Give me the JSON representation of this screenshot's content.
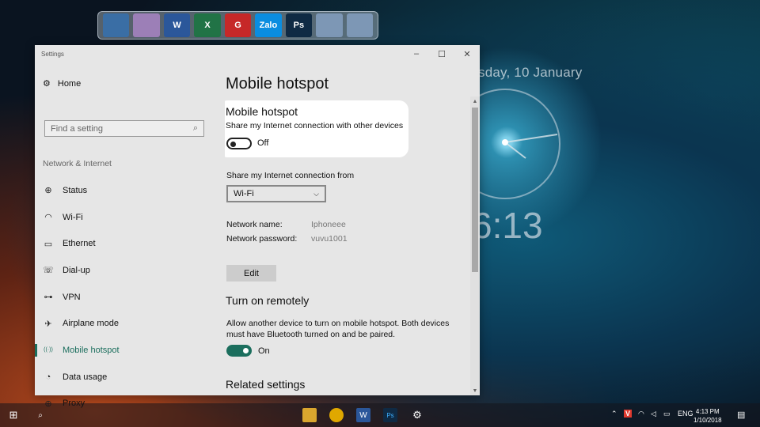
{
  "desktop": {
    "lock_date": "sday, 10 January",
    "lock_time": "6:13"
  },
  "dock": {
    "apps": [
      {
        "name": "this-pc",
        "glyph": "",
        "color": "#3a6ea5"
      },
      {
        "name": "recycle-bin",
        "glyph": "",
        "color": "#9c7fb7"
      },
      {
        "name": "word",
        "glyph": "W",
        "color": "#2b579a"
      },
      {
        "name": "excel",
        "glyph": "X",
        "color": "#217346"
      },
      {
        "name": "garena",
        "glyph": "G",
        "color": "#c62828"
      },
      {
        "name": "zalo",
        "glyph": "Zalo",
        "color": "#0a8de0"
      },
      {
        "name": "photoshop",
        "glyph": "Ps",
        "color": "#0f2a44"
      },
      {
        "name": "folder-1",
        "glyph": "",
        "color": "#7d97b5"
      },
      {
        "name": "folder-2",
        "glyph": "",
        "color": "#7d97b5"
      }
    ]
  },
  "window": {
    "title": "Settings",
    "controls": {
      "minimize": "–",
      "maximize": "☐",
      "close": "✕"
    }
  },
  "nav": {
    "home_label": "Home",
    "search_placeholder": "Find a setting",
    "section": "Network & Internet",
    "items": [
      {
        "label": "Status",
        "icon": "globe-icon",
        "glyph": "⊕"
      },
      {
        "label": "Wi-Fi",
        "icon": "wifi-icon",
        "glyph": "◠"
      },
      {
        "label": "Ethernet",
        "icon": "ethernet-icon",
        "glyph": "▭"
      },
      {
        "label": "Dial-up",
        "icon": "dialup-icon",
        "glyph": "☏"
      },
      {
        "label": "VPN",
        "icon": "vpn-icon",
        "glyph": "⊶"
      },
      {
        "label": "Airplane mode",
        "icon": "airplane-icon",
        "glyph": "✈"
      },
      {
        "label": "Mobile hotspot",
        "icon": "hotspot-icon",
        "glyph": "((·))"
      },
      {
        "label": "Data usage",
        "icon": "data-usage-icon",
        "glyph": "◔"
      },
      {
        "label": "Proxy",
        "icon": "proxy-icon",
        "glyph": "⊕"
      }
    ],
    "active_index": 6
  },
  "content": {
    "page_title": "Mobile hotspot",
    "hotspot": {
      "title": "Mobile hotspot",
      "description": "Share my Internet connection with other devices",
      "toggle_state": "Off"
    },
    "share_from": {
      "label": "Share my Internet connection from",
      "selected": "Wi-Fi"
    },
    "network_name": {
      "label": "Network name:",
      "value": "Iphoneee"
    },
    "network_password": {
      "label": "Network password:",
      "value": "vuvu1001"
    },
    "edit_label": "Edit",
    "remote": {
      "title": "Turn on remotely",
      "description": "Allow another device to turn on mobile hotspot. Both devices must have Bluetooth turned on and be paired.",
      "toggle_state": "On"
    },
    "related_title": "Related settings"
  },
  "taskbar": {
    "language": "ENG",
    "time": "4:13 PM",
    "date": "1/10/2018"
  },
  "colors": {
    "accent": "#1b6e5d"
  }
}
